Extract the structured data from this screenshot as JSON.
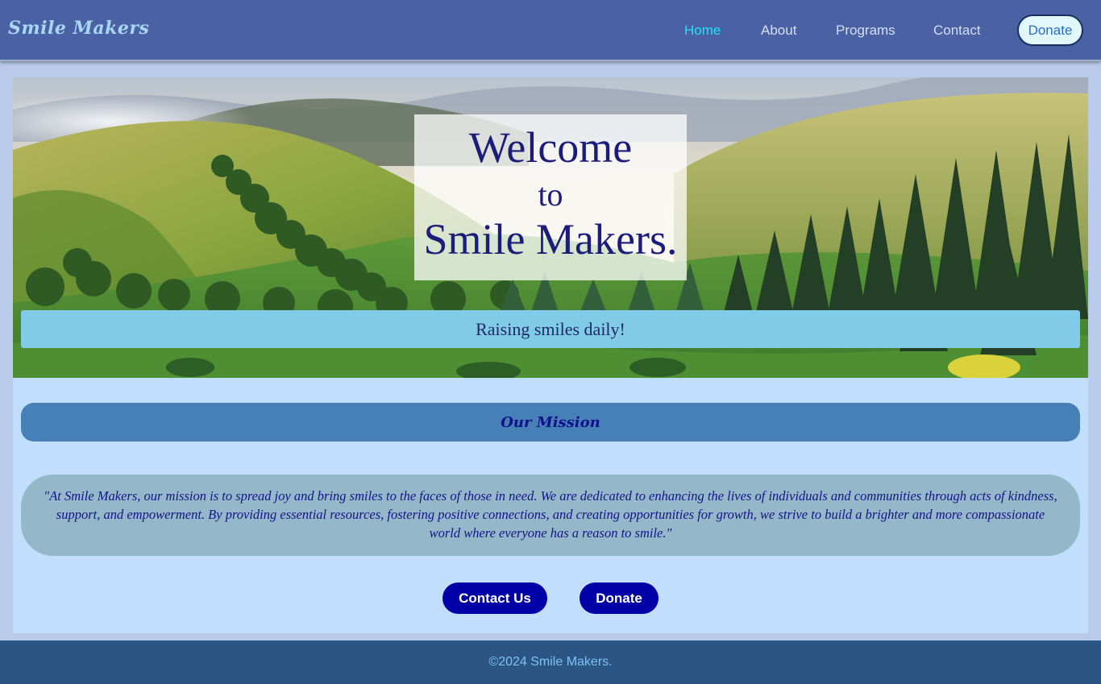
{
  "header": {
    "logo": "Smile Makers",
    "nav": [
      "Home",
      "About",
      "Programs",
      "Contact"
    ],
    "active_nav": "Home",
    "donate_label": "Donate"
  },
  "hero": {
    "welcome_line1": "Welcome",
    "welcome_line2": "to",
    "welcome_line3": "Smile Makers.",
    "tagline": "Raising smiles daily!"
  },
  "mission": {
    "heading": "Our Mission",
    "text": "\"At Smile Makers, our mission is to spread joy and bring smiles to the faces of those in need. We are dedicated to enhancing the lives of individuals and communities through acts of kindness, support, and empowerment. By providing essential resources, fostering positive connections, and creating opportunities for growth, we strive to build a brighter and more compassionate world where everyone has a reason to smile.\""
  },
  "actions": {
    "contact_label": "Contact Us",
    "donate_label": "Donate"
  },
  "footer": {
    "text": "©2024 Smile Makers."
  },
  "colors": {
    "navbar": "#4a62a3",
    "active_link": "#22e3f5",
    "page_bg": "#c2defd",
    "mission_head": "#4680b7",
    "mission_text_bg": "#94b8c9",
    "button": "#0000a6",
    "footer": "#2b5683"
  }
}
